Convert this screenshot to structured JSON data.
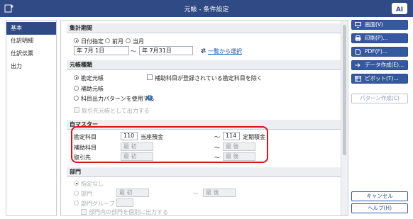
{
  "window": {
    "title": "元帳 - 条件設定"
  },
  "sidebar": {
    "items": [
      {
        "label": "基本"
      },
      {
        "label": "仕訳明細"
      },
      {
        "label": "仕訳伝票"
      },
      {
        "label": "出力"
      }
    ]
  },
  "period": {
    "heading": "集計期間",
    "opt_date": "日付指定",
    "opt_prev": "前月",
    "opt_curr": "当月",
    "from_date": "年  7月  1日",
    "to_date": "年  7月31日",
    "tilde": "〜",
    "select_link": "一覧から選択"
  },
  "ledger_type": {
    "heading": "元帳種類",
    "opt_account": "勘定元帳",
    "opt_sub": "補助元帳",
    "opt_pattern": "科目出力パターンを使用する",
    "exclude_label": "補助科目が登録されている勘定科目を除く",
    "partner_label": "取引先元帳として出力する"
  },
  "master": {
    "heading": "自マスター",
    "account_label": "勘定科目",
    "account_from_code": "110",
    "account_from_name": "当座預金",
    "account_to_code": "114",
    "account_to_name": "定期積金",
    "sub_label": "補助科目",
    "sub_from": "最 初",
    "sub_to": "最 後",
    "partner_label": "取引先",
    "partner_from": "最 初",
    "partner_to": "最 後",
    "tilde": "〜"
  },
  "dept": {
    "heading": "部門",
    "opt_none": "指定なし",
    "opt_dept": "部門",
    "dept_from": "最 初",
    "dept_to": "最 後",
    "opt_group": "部門グループ",
    "tilde": "〜",
    "footer_text": "部門内の部門を個別に出力する"
  },
  "actions": {
    "screen": "画面(V)",
    "print": "印刷(P)...",
    "pdf": "PDF(F)...",
    "data": "データ作成(E)...",
    "pivot": "ピボット(T)...",
    "pattern": "パターン作成(C)",
    "cancel": "キャンセル",
    "help": "ヘルプ(H)"
  },
  "colors": {
    "titlebar": "#2f4a84",
    "accent": "#3559a0",
    "highlight": "#d6141a",
    "link": "#1a55b5"
  }
}
